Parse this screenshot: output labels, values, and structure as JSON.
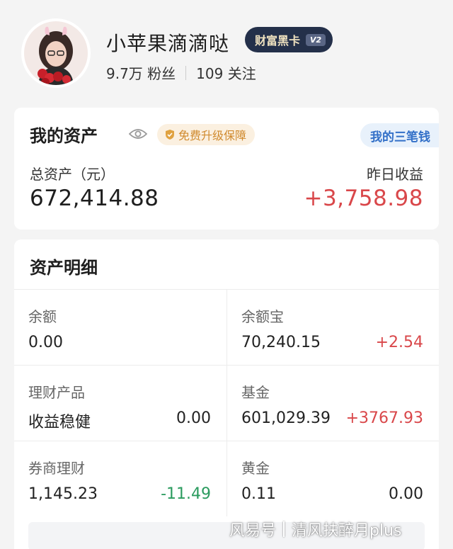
{
  "profile": {
    "username": "小苹果滴滴哒",
    "badge_label": "财富黑卡",
    "badge_version": "V2",
    "fans_count": "9.7万",
    "fans_label": "粉丝",
    "follow_count": "109",
    "follow_label": "关注"
  },
  "assets": {
    "title": "我的资产",
    "upgrade_label": "免费升级保障",
    "sanbi_label": "我的三笔钱",
    "total_label": "总资产（元）",
    "total_value": "672,414.88",
    "yesterday_label": "昨日收益",
    "yesterday_value": "+3,758.98"
  },
  "detail": {
    "title": "资产明细",
    "items": [
      {
        "label": "余额",
        "value": "0.00",
        "change": ""
      },
      {
        "label": "余额宝",
        "value": "70,240.15",
        "change": "+2.54"
      },
      {
        "label": "理财产品",
        "value": "收益稳健",
        "change": "0.00"
      },
      {
        "label": "基金",
        "value": "601,029.39",
        "change": "+3767.93"
      },
      {
        "label": "券商理财",
        "value": "1,145.23",
        "change": "-11.49"
      },
      {
        "label": "黄金",
        "value": "0.11",
        "change": "0.00"
      }
    ]
  },
  "watermark": {
    "source": "风易号",
    "author": "清风扶醉月plus"
  },
  "colors": {
    "gain": "#d9474a",
    "loss": "#2a9b5e",
    "badge_bg": "#24304a",
    "accent_blue": "#3370c8"
  },
  "icons": [
    "eye-icon",
    "shield-check-icon"
  ]
}
